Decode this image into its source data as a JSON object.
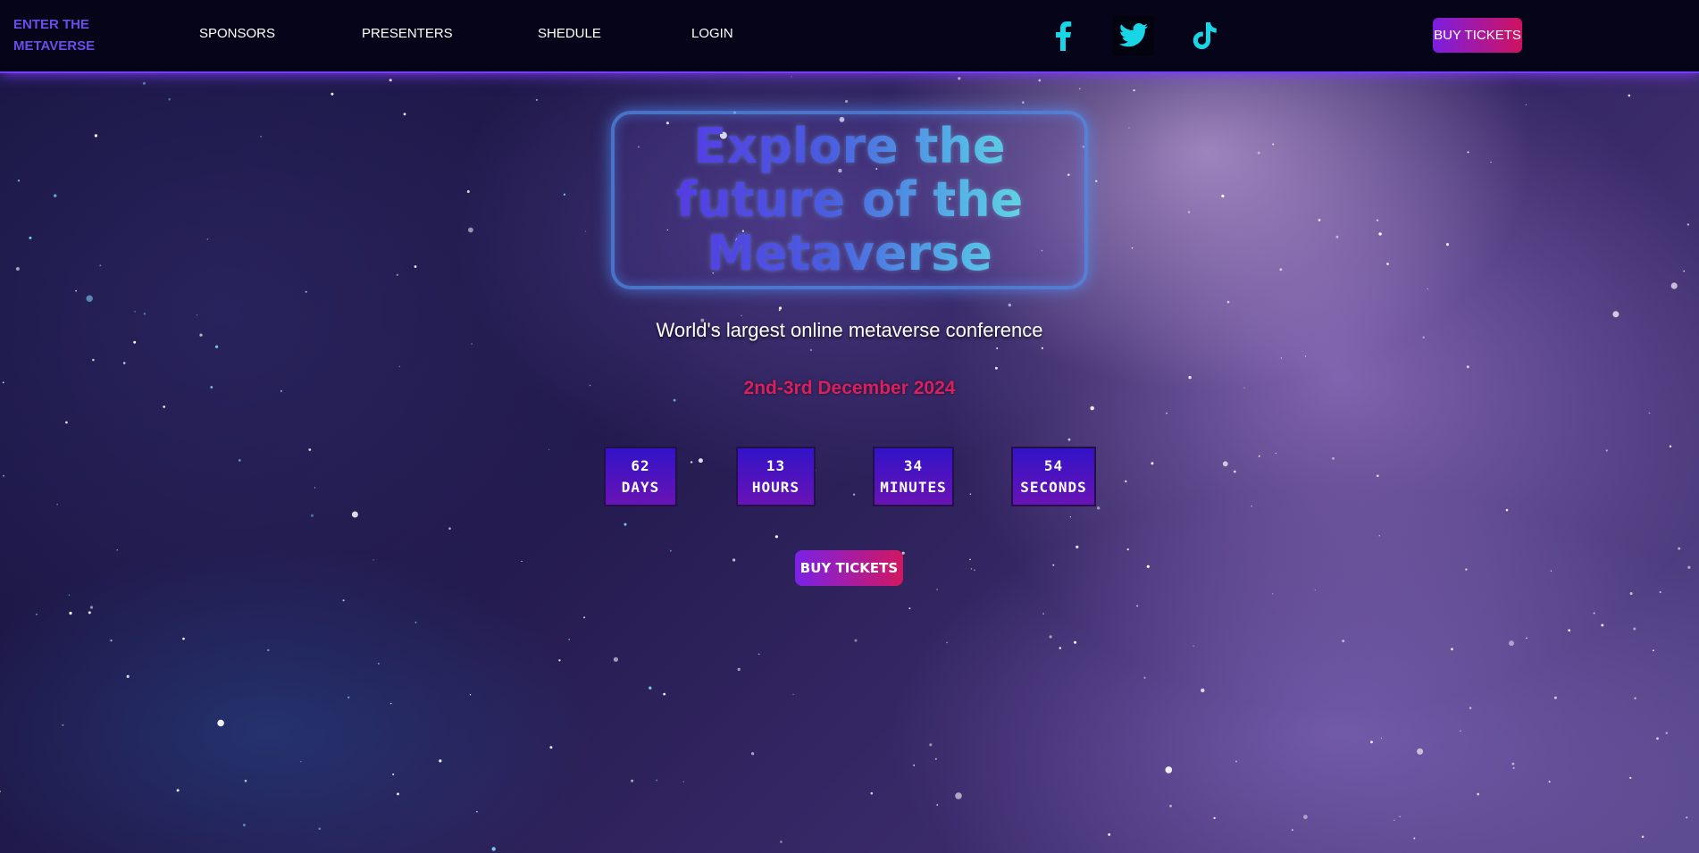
{
  "nav": {
    "brand": "ENTER THE METAVERSE",
    "links": [
      "SPONSORS",
      "PRESENTERS",
      "SHEDULE",
      "LOGIN"
    ],
    "social_icons": [
      "facebook-icon",
      "twitter-icon",
      "tiktok-icon"
    ],
    "buy_label": "BUY TICKETS"
  },
  "hero": {
    "title": "Explore the future of the Metaverse",
    "subtitle": "World's largest online metaverse conference",
    "date": "2nd-3rd December 2024"
  },
  "countdown": [
    {
      "value": "62",
      "unit": "DAYS"
    },
    {
      "value": "13",
      "unit": "HOURS"
    },
    {
      "value": "34",
      "unit": "MINUTES"
    },
    {
      "value": "54",
      "unit": "SECONDS"
    }
  ],
  "cta": {
    "buy_label": "BUY TICKETS"
  },
  "colors": {
    "nav_bg": "#050419",
    "brand": "#6c4de8",
    "social": "#18d6e6",
    "button_start": "#7b1fe0",
    "button_end": "#d0125f",
    "date": "#d8205e",
    "countdown_top": "#3213c8",
    "countdown_bottom": "#6913b5"
  }
}
